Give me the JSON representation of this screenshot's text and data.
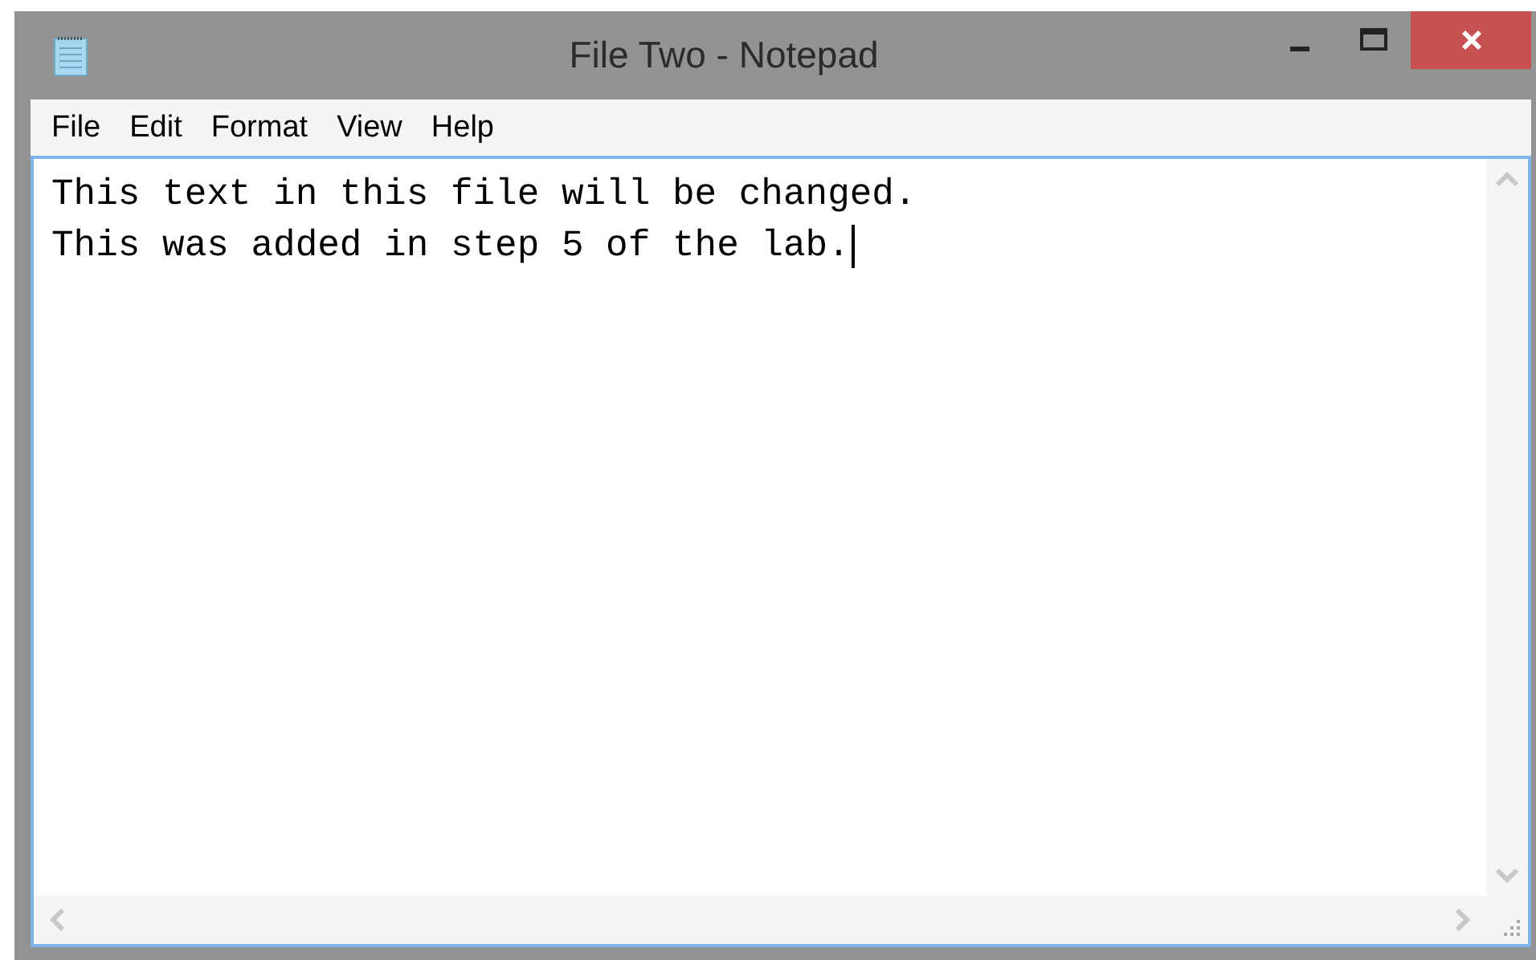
{
  "window": {
    "title": "File Two - Notepad"
  },
  "menu": [
    "File",
    "Edit",
    "Format",
    "View",
    "Help"
  ],
  "document": {
    "lines": [
      "This text in this file will be changed.",
      "This was added in step 5 of the lab."
    ]
  }
}
